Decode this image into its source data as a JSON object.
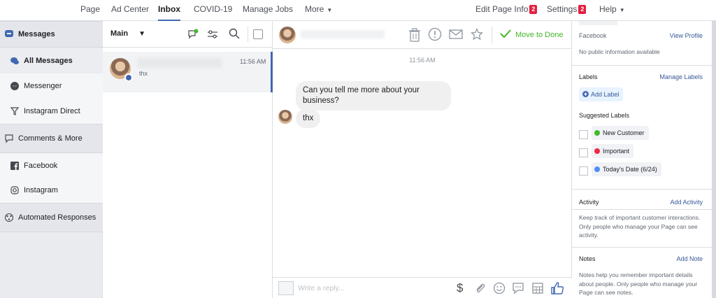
{
  "nav": {
    "items": [
      "Page",
      "Ad Center",
      "Inbox",
      "COVID-19",
      "Manage Jobs",
      "More"
    ],
    "right_items": {
      "edit_page_info": "Edit Page Info",
      "edit_badge": "2",
      "settings": "Settings",
      "settings_badge": "2",
      "help": "Help"
    }
  },
  "sidebar": {
    "messages": "Messages",
    "all_messages": "All Messages",
    "messenger": "Messenger",
    "instagram_direct": "Instagram Direct",
    "comments_more": "Comments & More",
    "facebook": "Facebook",
    "instagram": "Instagram",
    "automated": "Automated Responses"
  },
  "convlist": {
    "folder": "Main",
    "item": {
      "time": "11:56 AM",
      "preview": "thx"
    }
  },
  "chat": {
    "move_to_done": "Move to Done",
    "timestamp": "11:56 AM",
    "messages": [
      {
        "text": "Can you tell me more about your business?"
      },
      {
        "text": "thx"
      }
    ],
    "composer_placeholder": "Write a reply..."
  },
  "rpanel": {
    "facebook_title": "Facebook",
    "view_profile": "View Profile",
    "no_public_info": "No public information available",
    "labels_title": "Labels",
    "manage_labels": "Manage Labels",
    "add_label": "Add Label",
    "suggested_labels": "Suggested Labels",
    "labels": [
      {
        "name": "New Customer",
        "color": "#42b72a"
      },
      {
        "name": "Important",
        "color": "#f02849"
      },
      {
        "name": "Today's Date (6/24)",
        "color": "#4e8ef7"
      }
    ],
    "activity_title": "Activity",
    "add_activity": "Add Activity",
    "activity_text": "Keep track of important customer interactions. Only people who manage your Page can see activity.",
    "notes_title": "Notes",
    "add_note": "Add Note",
    "notes_text": "Notes help you remember important details about people. Only people who manage your Page can see notes."
  },
  "colors": {
    "accent": "#4267b2",
    "done_green": "#42b72a",
    "link": "#385898"
  }
}
